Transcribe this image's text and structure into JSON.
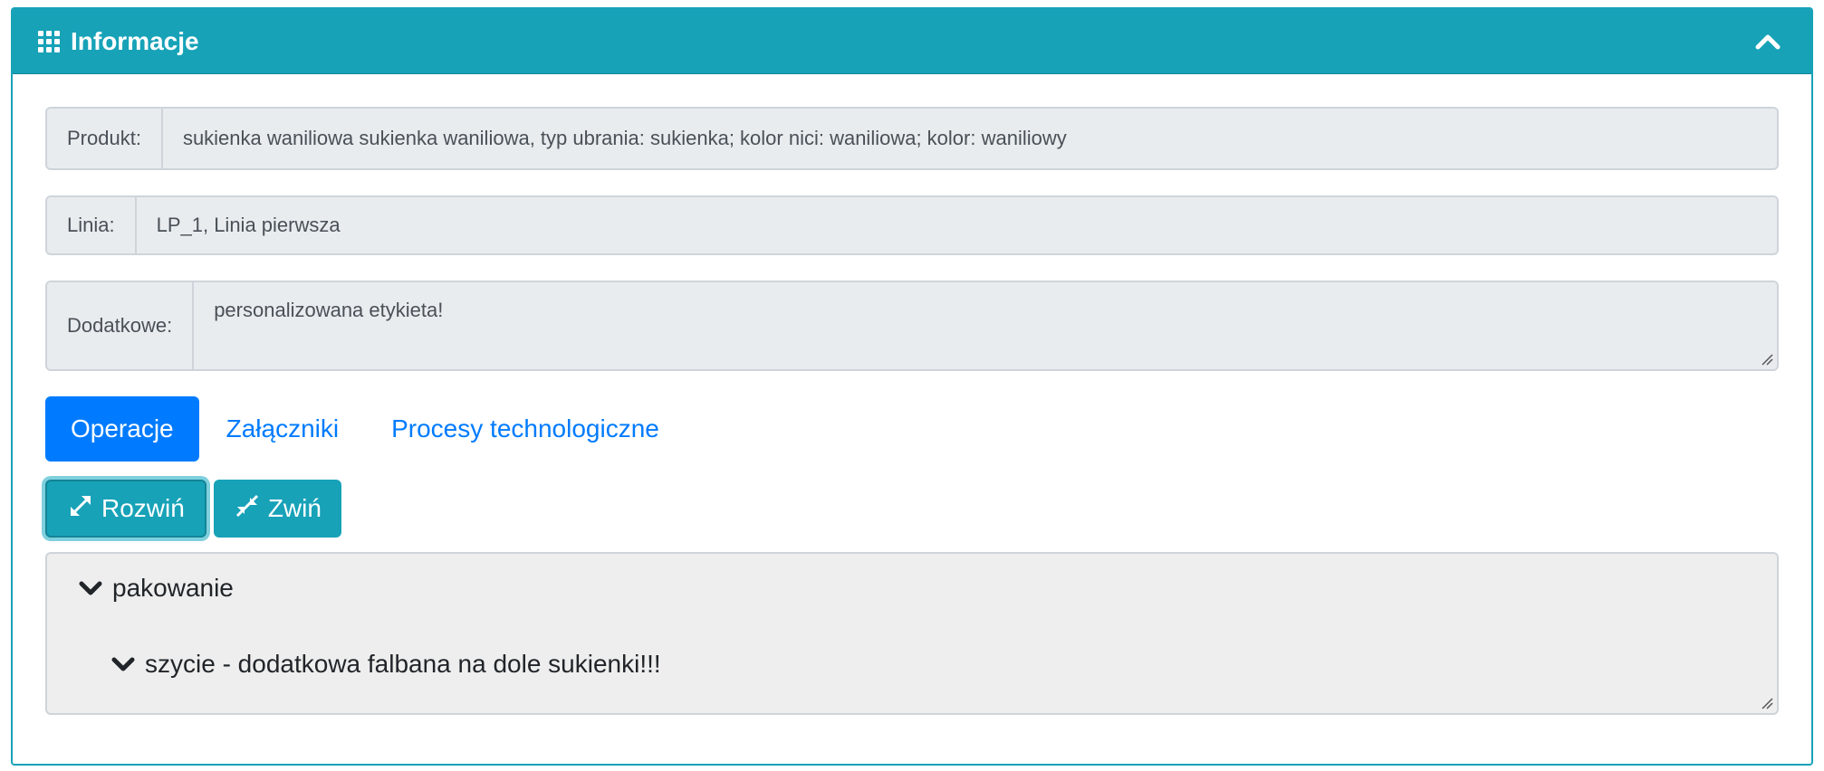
{
  "header": {
    "title": "Informacje",
    "icon": "grid-icon",
    "collapse_icon": "chevron-up-icon",
    "color": "#17a2b8"
  },
  "fields": {
    "produkt": {
      "label": "Produkt:",
      "value": "sukienka waniliowa sukienka waniliowa, typ ubrania: sukienka; kolor nici: waniliowa; kolor: waniliowy"
    },
    "linia": {
      "label": "Linia:",
      "value": "LP_1, Linia pierwsza"
    },
    "dodatkowe": {
      "label": "Dodatkowe:",
      "value": "personalizowana etykieta!"
    }
  },
  "tabs": [
    {
      "label": "Operacje",
      "active": true
    },
    {
      "label": "Załączniki",
      "active": false
    },
    {
      "label": "Procesy technologiczne",
      "active": false
    }
  ],
  "buttons": {
    "expand_label": "Rozwiń",
    "collapse_label": "Zwiń"
  },
  "tree": {
    "items": [
      {
        "label": "pakowanie",
        "icon": "chevron-down-icon"
      },
      {
        "label": "szycie - dodatkowa falbana na dole sukienki!!!",
        "icon": "chevron-down-icon"
      }
    ]
  },
  "colors": {
    "accent": "#17a2b8",
    "primary": "#007bff",
    "field_bg": "#e9ecef"
  }
}
